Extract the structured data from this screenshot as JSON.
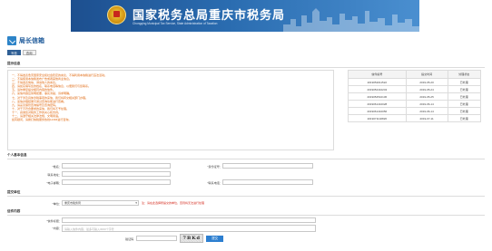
{
  "banner": {
    "title": "国家税务总局重庆市税务局",
    "subtitle": "Chongqing Municipal Tax Service, State Administration of Taxation"
  },
  "page": {
    "title": "局长信箱"
  },
  "tabs": [
    {
      "label": "写信",
      "active": true
    },
    {
      "label": "查询",
      "active": false
    }
  ],
  "notice": {
    "section_label": "提示信息",
    "lines": [
      "一、不得发表危害国家安全和社会稳定的言论，不得利用本信箱进行违法活动。",
      "二、不得使用本信箱发布广告或者其他商业信息。",
      "三、不得发表侮辱、诽谤他人的言论。",
      "四、请如实填写您的姓名、联系电话等信息，以便我们与您联系。",
      "五、请勿重复提交相同内容的信件。",
      "六、来信内容应简明扼要，事实清楚，诉求明确。",
      "七、对于涉及具体涉税事项的来信，我们将转交相关部门办理。",
      "八、来信办理结果可通过查询功能进行查看。",
      "九、请妥善保管查询编号及查询密码。",
      "十、对于不符合要求的来信，我们将不予处理。",
      "十一、感谢您对税务工作的关心和支持。",
      "十二、请遵守相关法律法规，文明用语。",
      "如有疑问，请拨打纳税服务热线12366进行咨询。"
    ]
  },
  "results_table": {
    "headers": [
      "信件编号",
      "提交时间",
      "处理状态"
    ],
    "rows": [
      [
        "2019052011522",
        "2019-05-20",
        "已处理"
      ],
      [
        "2019052410243",
        "2019-05-24",
        "已处理"
      ],
      [
        "2019052510136",
        "2019-05-25",
        "已处理"
      ],
      [
        "2019061410028",
        "2019-06-14",
        "已处理"
      ],
      [
        "2019061410056",
        "2019-06-14",
        "已处理"
      ],
      [
        "2019071102826",
        "2019-07-11",
        "已处理"
      ]
    ]
  },
  "personal": {
    "section_label": "个人基本信息",
    "name_label": "*姓名：",
    "idcard_label": "*身份证号：",
    "address_label": "联系地址：",
    "email_label": "*电子邮箱：",
    "phone_label": "*联系电话："
  },
  "unit": {
    "section_label": "提交单位",
    "unit_label": "*单位：",
    "unit_value": "重庆市税务局",
    "unit_hint": "注：请在此选择所提交的单位，否则将无法进行处理"
  },
  "letter": {
    "section_label": "信件内容",
    "subject_label": "*信件标题：",
    "content_label": "*内容：",
    "content_placeholder": "请输入信件内容，最多可输入3000个字符"
  },
  "captcha": {
    "label": "验证码",
    "image_text": "7BKd",
    "submit_label": "提交"
  }
}
